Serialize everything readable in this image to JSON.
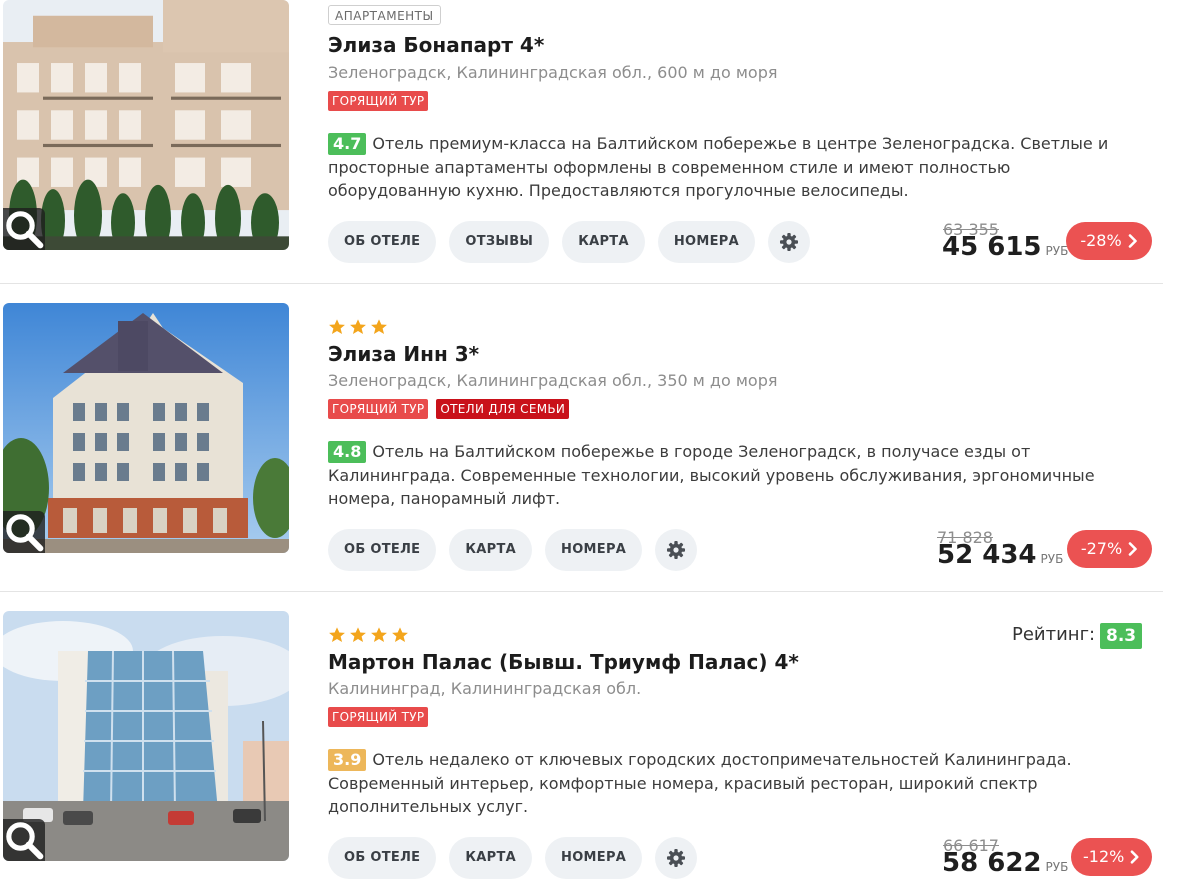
{
  "hotels": [
    {
      "type_badge": "АПАРТАМЕНТЫ",
      "stars": 0,
      "name": "Элиза Бонапарт 4*",
      "location": "Зеленоградск, Калининградская обл., 600 м до моря",
      "tags": [
        "ГОРЯЩИЙ ТУР"
      ],
      "score": "4.7",
      "score_color": "#4cbe5a",
      "description": "Отель премиум-класса на Балтийском побережье в центре Зеленоградска. Светлые и просторные апартаменты оформлены в современном стиле и имеют полностью оборудованную кухню. Предоставляются прогулочные велосипеды.",
      "buttons": [
        "ОБ ОТЕЛЕ",
        "ОТЗЫВЫ",
        "КАРТА",
        "НОМЕРА"
      ],
      "old_price": "63 355",
      "price": "45 615",
      "currency": "РУБ",
      "discount": "-28%",
      "photo_icon": "search-icon"
    },
    {
      "type_badge": "",
      "stars": 3,
      "name": "Элиза Инн 3*",
      "location": "Зеленоградск, Калининградская обл., 350 м до моря",
      "tags": [
        "ГОРЯЩИЙ ТУР",
        "ОТЕЛИ ДЛЯ СЕМЬИ"
      ],
      "score": "4.8",
      "score_color": "#4cbe5a",
      "description": "Отель на Балтийском побережье в городе Зеленоградск, в получасе езды от Калининграда. Современные технологии, высокий уровень обслуживания, эргономичные номера, панорамный лифт.",
      "buttons": [
        "ОБ ОТЕЛЕ",
        "КАРТА",
        "НОМЕРА"
      ],
      "old_price": "71 828",
      "price": "52 434",
      "currency": "РУБ",
      "discount": "-27%",
      "photo_icon": "search-icon"
    },
    {
      "type_badge": "",
      "stars": 4,
      "name": "Мартон Палас (Бывш. Триумф Палас) 4*",
      "location": "Калининград, Калининградская обл.",
      "tags": [
        "ГОРЯЩИЙ ТУР"
      ],
      "rating_label": "Рейтинг:",
      "rating_value": "8.3",
      "score": "3.9",
      "score_color": "#edb75a",
      "description": "Отель недалеко от ключевых городских достопримечательностей Калининграда. Современный интерьер, комфортные номера, красивый ресторан, широкий спектр дополнительных услуг.",
      "buttons": [
        "ОБ ОТЕЛЕ",
        "КАРТА",
        "НОМЕРА"
      ],
      "old_price": "66 617",
      "price": "58 622",
      "currency": "РУБ",
      "discount": "-12%",
      "photo_icon": "search-icon"
    }
  ],
  "colors": {
    "hot_tag": "#e84b4b",
    "family_tag": "#c9111a",
    "discount": "#eb5252",
    "score_green": "#4cbe5a",
    "score_yellow": "#edb75a",
    "star": "#f3a51c",
    "pill_bg": "#eef1f4"
  }
}
